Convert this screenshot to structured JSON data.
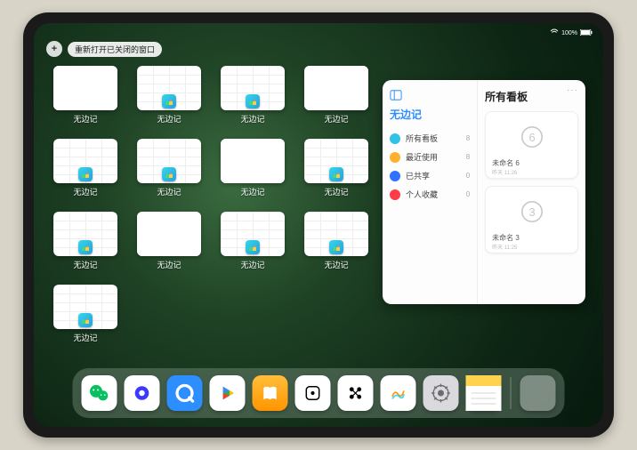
{
  "status": {
    "time": "",
    "battery": "100%"
  },
  "top": {
    "plus": "+",
    "restoreLabel": "重新打开已关闭的窗口"
  },
  "appLabel": "无边记",
  "thumbs": [
    {
      "style": "blank"
    },
    {
      "style": "grid"
    },
    {
      "style": "grid"
    },
    {
      "style": "blank"
    },
    {
      "style": "grid"
    },
    {
      "style": "grid"
    },
    {
      "style": "blank"
    },
    {
      "style": "grid"
    },
    {
      "style": "grid"
    },
    {
      "style": "blank"
    },
    {
      "style": "grid"
    },
    {
      "style": "grid"
    },
    {
      "style": "grid"
    }
  ],
  "panel": {
    "leftTitle": "无边记",
    "rightTitle": "所有看板",
    "items": [
      {
        "label": "所有看板",
        "count": 8,
        "color": "#32c1e8"
      },
      {
        "label": "最近使用",
        "count": 8,
        "color": "#ffb02e"
      },
      {
        "label": "已共享",
        "count": 0,
        "color": "#2f72ff"
      },
      {
        "label": "个人收藏",
        "count": 0,
        "color": "#ff3b47"
      }
    ],
    "boards": [
      {
        "name": "未命名 6",
        "sub": "昨天 11:26",
        "digit": "6"
      },
      {
        "name": "未命名 3",
        "sub": "昨天 11:25",
        "digit": "3"
      }
    ],
    "more": "···"
  },
  "dock": {
    "apps": [
      {
        "name": "wechat",
        "bg": "#ffffff",
        "glyphColor": "#07c160"
      },
      {
        "name": "quark",
        "bg": "#ffffff",
        "glyphColor": "#3b39ff"
      },
      {
        "name": "qqbrowser",
        "bg": "#2d8fff",
        "glyphColor": "#ffffff"
      },
      {
        "name": "play",
        "bg": "#ffffff",
        "glyphColor": "#34a853"
      },
      {
        "name": "books",
        "bg": "linear-gradient(180deg,#ffbe3b,#ff9500)",
        "glyphColor": "#ffffff"
      },
      {
        "name": "dice",
        "bg": "#ffffff",
        "glyphColor": "#000000"
      },
      {
        "name": "connect",
        "bg": "#ffffff",
        "glyphColor": "#000000"
      },
      {
        "name": "freeform",
        "bg": "#ffffff",
        "glyphColor": "#35d6ed"
      },
      {
        "name": "settings",
        "bg": "#d9d9de",
        "glyphColor": "#6b6b70"
      },
      {
        "name": "notes",
        "bg": "#ffffff",
        "glyphColor": "#ffd34d"
      }
    ],
    "recentGroup": {
      "tiles": [
        "#4aa0ff",
        "#34c759",
        "#ff9500",
        "#5ac8fa"
      ]
    }
  }
}
